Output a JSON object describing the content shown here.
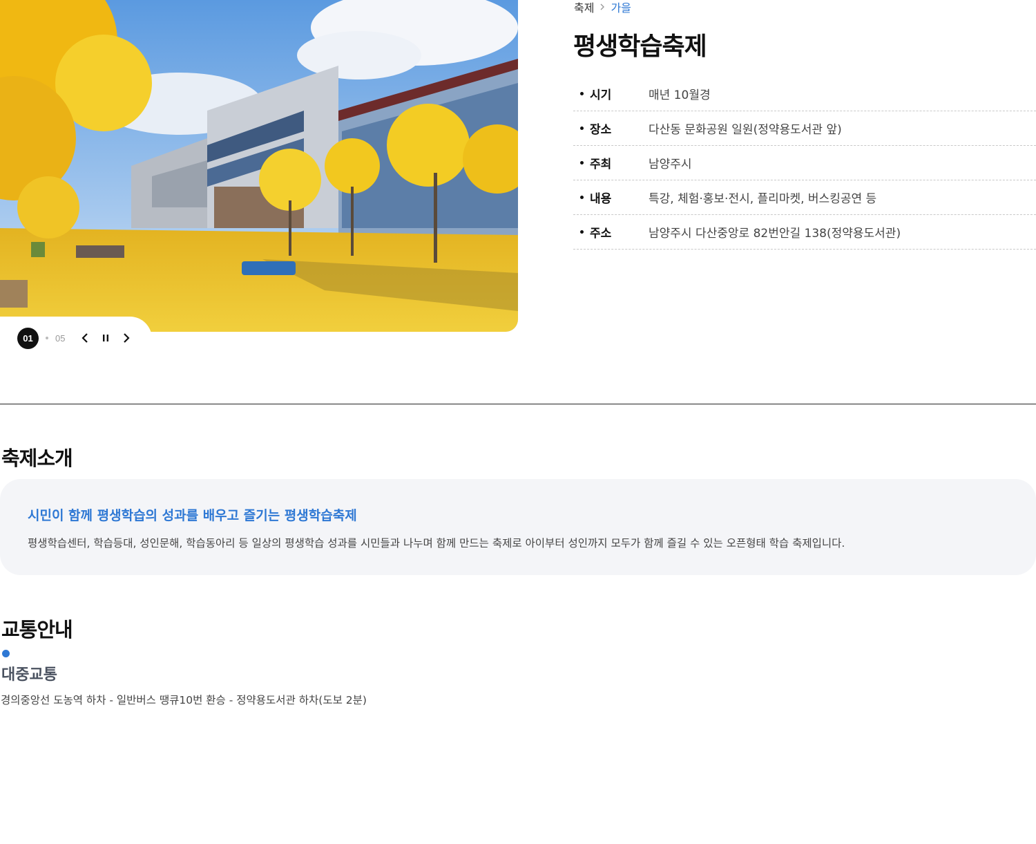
{
  "gallery": {
    "image_alt": "autumn library with ginkgo trees",
    "current": "01",
    "total": "05",
    "prev_icon": "chevron-left-icon",
    "pause_icon": "pause-icon",
    "next_icon": "chevron-right-icon"
  },
  "breadcrumb": {
    "items": [
      "축제",
      "가을"
    ],
    "separator_icon": "chevron-right-icon"
  },
  "title": "평생학습축제",
  "info": [
    {
      "label": "시기",
      "value": "매년 10월경"
    },
    {
      "label": "장소",
      "value": "다산동 문화공원 일원(정약용도서관 앞)"
    },
    {
      "label": "주최",
      "value": "남양주시"
    },
    {
      "label": "내용",
      "value": "특강, 체험·홍보·전시, 플리마켓, 버스킹공연 등"
    },
    {
      "label": "주소",
      "value": "남양주시 다산중앙로 82번안길 138(정약용도서관)"
    }
  ],
  "intro": {
    "title": "축제소개",
    "highlight": "시민이 함께 평생학습의 성과를 배우고 즐기는 평생학습축제",
    "description": "평생학습센터, 학습등대, 성인문해, 학습동아리 등 일상의 평생학습 성과를 시민들과 나누며 함께 만드는 축제로 아이부터 성인까지 모두가 함께 즐길 수 있는 오픈형태 학습 축제입니다."
  },
  "transport": {
    "title": "교통안내",
    "subtitle": "대중교통",
    "description": "경의중앙선 도농역 하차 - 일반버스 땡큐10번 환승 - 정약용도서관 하차(도보 2분)"
  },
  "colors": {
    "accent": "#2e78d4",
    "intro_bg": "#f4f5f8",
    "ginkgo": "#f2c418"
  }
}
